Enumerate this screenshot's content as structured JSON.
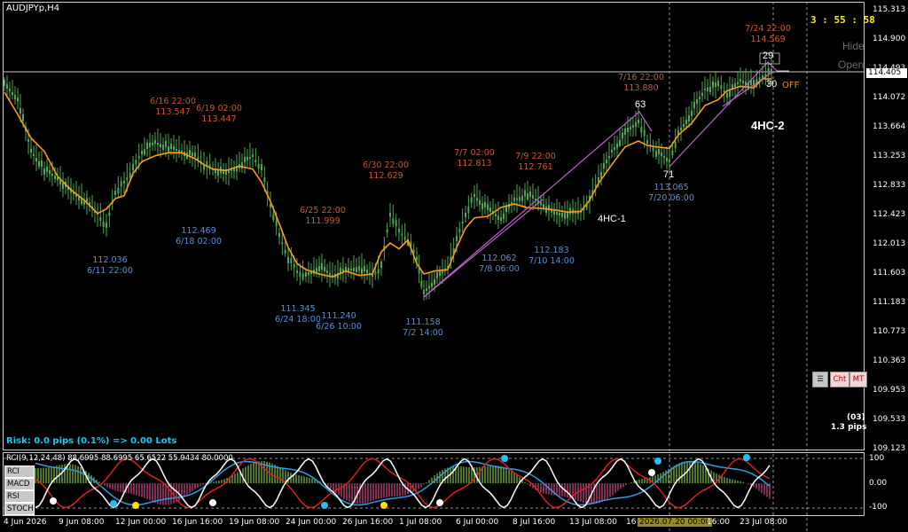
{
  "symbol": "AUDJPYp,H4",
  "timer": "3 : 55 : 58",
  "panel": {
    "hide": "Hide",
    "open": "Open",
    "off": "OFF"
  },
  "price_axis": [
    "115.313",
    "114.900",
    "114.493",
    "114.405",
    "114.072",
    "113.664",
    "113.253",
    "112.833",
    "112.423",
    "112.013",
    "111.603",
    "111.183",
    "110.773",
    "110.363",
    "109.953",
    "109.533",
    "109.123"
  ],
  "current_price": "114.405",
  "annotations_red": [
    {
      "date": "6/16 22:00",
      "price": "113.547"
    },
    {
      "date": "6/19 02:00",
      "price": "113.447"
    },
    {
      "date": "6/25 22:00",
      "price": "111.999"
    },
    {
      "date": "6/30 22:00",
      "price": "112.629"
    },
    {
      "date": "7/7 02:00",
      "price": "112.813"
    },
    {
      "date": "7/9 22:00",
      "price": "112.761"
    },
    {
      "date": "7/16 22:00",
      "price": "113.880"
    },
    {
      "date": "7/24 22:00",
      "price": "114.569"
    }
  ],
  "annotations_blue": [
    {
      "price": "112.036",
      "date": "6/11 22:00"
    },
    {
      "price": "112.469",
      "date": "6/18 02:00"
    },
    {
      "price": "111.345",
      "date": "6/24 18:00"
    },
    {
      "price": "111.240",
      "date": "6/26 10:00"
    },
    {
      "price": "111.158",
      "date": "7/2 14:00"
    },
    {
      "price": "112.062",
      "date": "7/8 06:00"
    },
    {
      "price": "112.183",
      "date": "7/10 14:00"
    },
    {
      "price": "113.065",
      "date": "7/20 06:00"
    }
  ],
  "wave_labels": {
    "w63": "63",
    "w71": "71",
    "w29": "29",
    "w30": "30"
  },
  "hc_labels": {
    "hc1": "4HC-1",
    "hc2": "4HC-2"
  },
  "risk": "Risk: 0.0 pips (0.1%) => 0.00 Lots",
  "spread": {
    "count": "(03)",
    "pips": "1.3 pips"
  },
  "chart_buttons": {
    "cht": "Cht",
    "mt": "MT"
  },
  "indicator": {
    "title": "RCI(9,12,24,48) 88.6995 88.6995 65.6522 55.9434 80.0000",
    "axis": [
      "100",
      "0.00",
      "-100"
    ],
    "tabs": [
      "RCI",
      "MACD",
      "RSI",
      "STOCH"
    ]
  },
  "time_axis": [
    "4 Jun 2026",
    "9 Jun 08:00",
    "12 Jun 00:00",
    "16 Jun 16:00",
    "19 Jun 08:00",
    "24 Jun 00:00",
    "26 Jun 16:00",
    "1 Jul 08:00",
    "6 Jul 00:00",
    "8 Jul 16:00",
    "13 Jul 08:00",
    "16",
    "2026.07.20 00:00",
    "16:00",
    "23 Jul 08:00"
  ],
  "colors": {
    "candle": "#4ea84e",
    "ma": "#ff9b1a",
    "trend": "#c060d0",
    "red_text": "#c8593c",
    "blue_text": "#5b8fd6",
    "timer": "#ffee22",
    "risk": "#00d0ff"
  }
}
